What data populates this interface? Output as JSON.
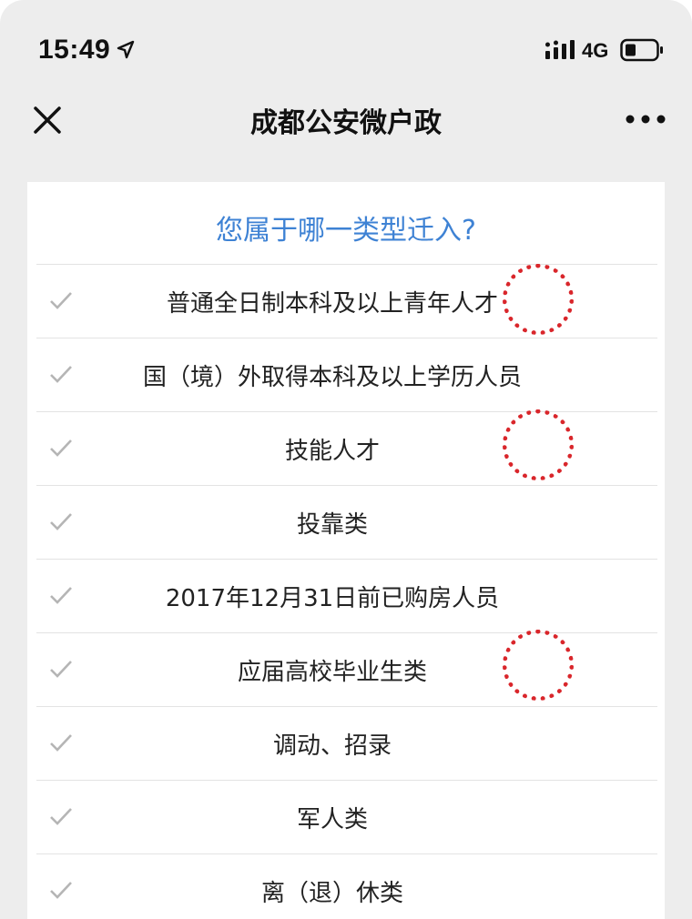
{
  "status_bar": {
    "time": "15:49",
    "network": "4G",
    "icons": [
      "location-arrow-icon",
      "signal-bars-icon",
      "battery-icon"
    ]
  },
  "nav": {
    "title": "成都公安微户政",
    "close_icon": "close-icon",
    "more_icon": "more-dots-icon"
  },
  "survey": {
    "question": "您属于哪一类型迁入?",
    "options": [
      {
        "label": "普通全日制本科及以上青年人才"
      },
      {
        "label": "国（境）外取得本科及以上学历人员"
      },
      {
        "label": "技能人才"
      },
      {
        "label": "投靠类"
      },
      {
        "label": "2017年12月31日前已购房人员"
      },
      {
        "label": "应届高校毕业生类"
      },
      {
        "label": "调动、招录"
      },
      {
        "label": "军人类"
      },
      {
        "label": "离（退）休类"
      }
    ]
  },
  "colors": {
    "background": "#ededed",
    "card": "#ffffff",
    "question_text": "#3e82d4",
    "check": "#b5b5b5",
    "annotation": "#d9262b"
  }
}
